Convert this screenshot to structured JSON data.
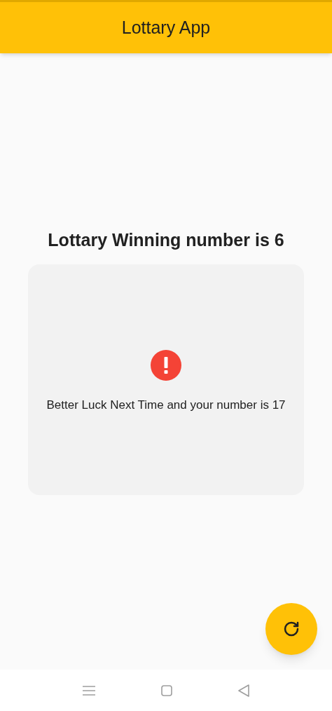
{
  "app_bar": {
    "title": "Lottary App"
  },
  "heading": "Lottary Winning number is 6",
  "result_card": {
    "kind": "lose",
    "message": "Better Luck Next Time and your number is 17"
  },
  "fab": {
    "kind": "refresh"
  }
}
